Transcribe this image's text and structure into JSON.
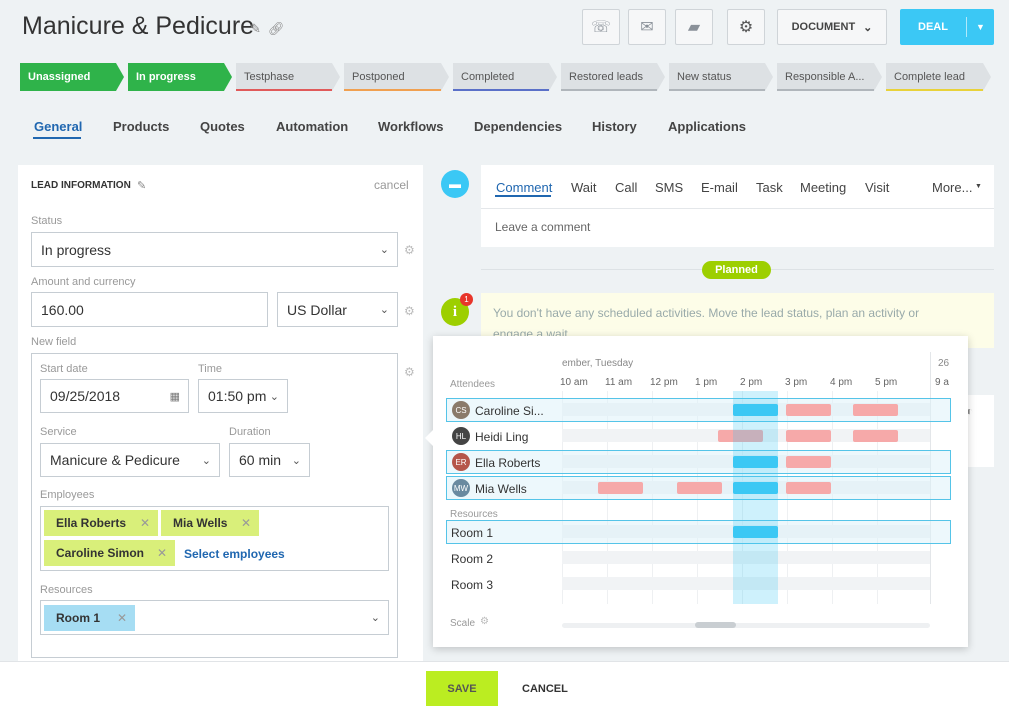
{
  "header": {
    "title": "Manicure & Pedicure",
    "document_label": "DOCUMENT",
    "deal_label": "DEAL"
  },
  "stages": [
    {
      "label": "Unassigned",
      "done": true,
      "color": "#2fb34a"
    },
    {
      "label": "In progress",
      "done": true,
      "color": "#2fb34a"
    },
    {
      "label": "Testphase",
      "done": false,
      "color": "#e05a5a"
    },
    {
      "label": "Postponed",
      "done": false,
      "color": "#f0a050"
    },
    {
      "label": "Completed",
      "done": false,
      "color": "#5a70c8"
    },
    {
      "label": "Restored leads",
      "done": false,
      "color": "#b0b6bb"
    },
    {
      "label": "New status",
      "done": false,
      "color": "#b0b6bb"
    },
    {
      "label": "Responsible A...",
      "done": false,
      "color": "#b0b6bb"
    },
    {
      "label": "Complete lead",
      "done": false,
      "color": "#e8d23a"
    }
  ],
  "tabs": [
    "General",
    "Products",
    "Quotes",
    "Automation",
    "Workflows",
    "Dependencies",
    "History",
    "Applications"
  ],
  "lead": {
    "section_title": "LEAD INFORMATION",
    "cancel_label": "cancel",
    "status_label": "Status",
    "status_value": "In progress",
    "amount_label": "Amount and currency",
    "amount_value": "160.00",
    "currency_value": "US Dollar",
    "new_field_label": "New field",
    "start_date_label": "Start date",
    "start_date_value": "09/25/2018",
    "time_label": "Time",
    "time_value": "01:50 pm",
    "service_label": "Service",
    "service_value": "Manicure & Pedicure",
    "duration_label": "Duration",
    "duration_value": "60 min",
    "employees_label": "Employees",
    "employees": [
      "Ella Roberts",
      "Mia Wells",
      "Caroline Simon"
    ],
    "select_employees": "Select employees",
    "resources_label": "Resources",
    "resources": [
      "Room 1"
    ]
  },
  "activity": {
    "tabs": [
      "Comment",
      "Wait",
      "Call",
      "SMS",
      "E-mail",
      "Task",
      "Meeting",
      "Visit",
      "More..."
    ],
    "comment_placeholder": "Leave a comment",
    "planned_label": "Planned",
    "info_text": "You don't have any scheduled activities. Move the lead status, plan an activity or engage a wait.",
    "info_badge": "1"
  },
  "scheduler": {
    "date_header": "ember, Tuesday",
    "next_day": "26",
    "attendees_label": "Attendees",
    "times": [
      "10 am",
      "11 am",
      "12 pm",
      "1 pm",
      "2 pm",
      "3 pm",
      "4 pm",
      "5 pm",
      "9 a"
    ],
    "attendees": [
      {
        "name": "Caroline Si...",
        "initials": "CS"
      },
      {
        "name": "Heidi Ling",
        "initials": "HL"
      },
      {
        "name": "Ella Roberts",
        "initials": "ER"
      },
      {
        "name": "Mia Wells",
        "initials": "MW"
      }
    ],
    "resources_label": "Resources",
    "rooms": [
      "Room 1",
      "Room 2",
      "Room 3"
    ],
    "scale_label": "Scale"
  },
  "footer": {
    "save_label": "SAVE",
    "cancel_label": "CANCEL"
  }
}
